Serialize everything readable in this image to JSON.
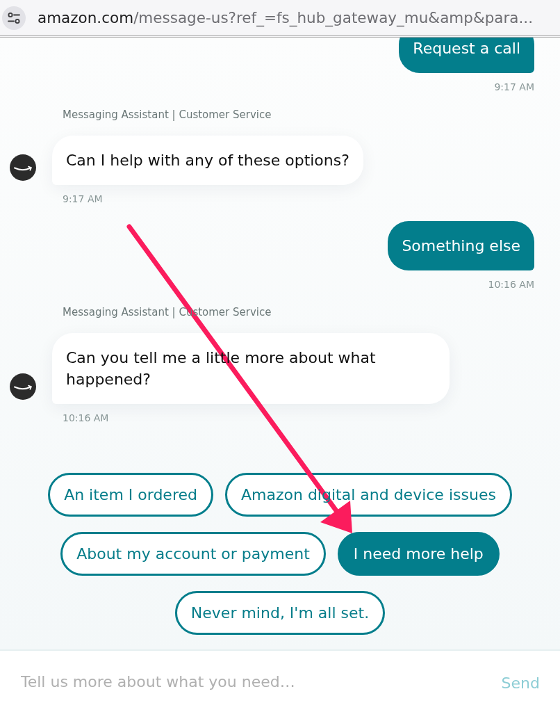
{
  "address_bar": {
    "domain": "amazon.com",
    "path": "/message-us?ref_=fs_hub_gateway_mu&amp&para..."
  },
  "messages": [
    {
      "kind": "outgoing",
      "text": "Request a call",
      "time": "9:17 AM"
    },
    {
      "kind": "incoming",
      "sender": "Messaging Assistant | Customer Service",
      "text": "Can I help with any of these options?",
      "time": "9:17 AM"
    },
    {
      "kind": "outgoing",
      "text": "Something else",
      "time": "10:16 AM"
    },
    {
      "kind": "incoming",
      "sender": "Messaging Assistant | Customer Service",
      "text": "Can you tell me a little more about what happened?",
      "time": "10:16 AM"
    }
  ],
  "quick_replies": [
    {
      "label": "An item I ordered",
      "selected": false
    },
    {
      "label": "Amazon digital and device issues",
      "selected": false
    },
    {
      "label": "About my account or payment",
      "selected": false
    },
    {
      "label": "I need more help",
      "selected": true
    },
    {
      "label": "Never mind, I'm all set.",
      "selected": false
    }
  ],
  "composer": {
    "placeholder": "Tell us more about what you need…",
    "send": {
      "label": "Send",
      "disabled": true
    }
  }
}
